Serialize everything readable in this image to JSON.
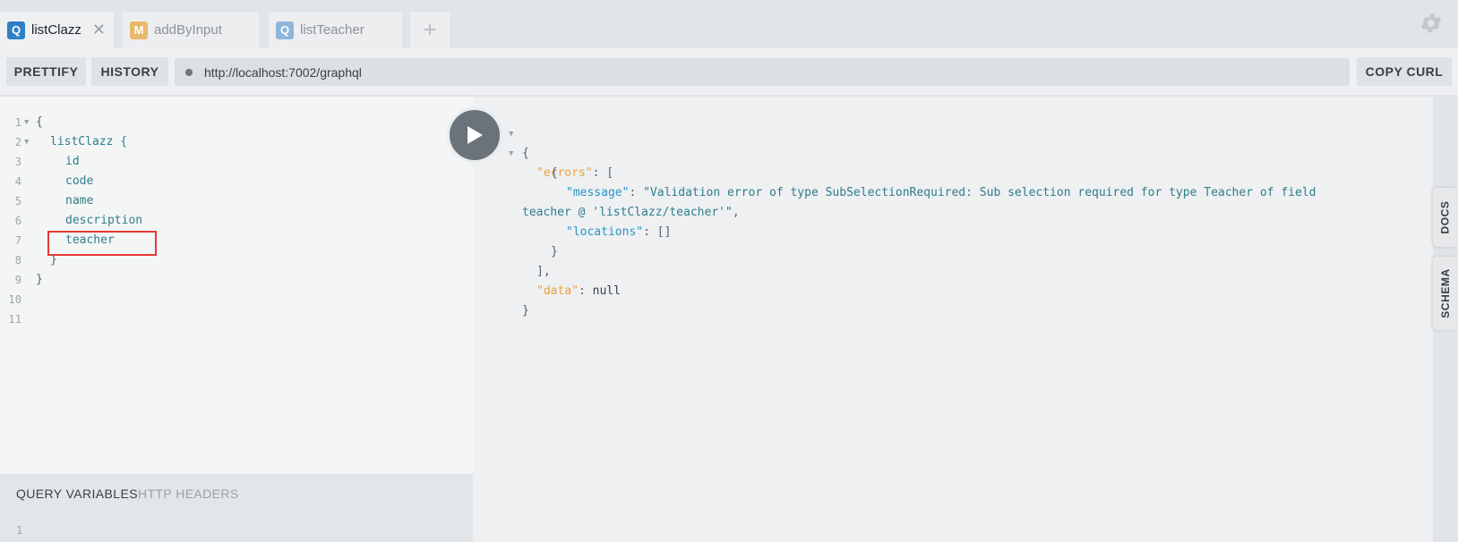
{
  "tabs": [
    {
      "badge": "Q",
      "label": "listClazz",
      "badge_color": "#2e7fc6",
      "closable": true,
      "active": true
    },
    {
      "badge": "M",
      "label": "addByInput",
      "badge_color": "#e8b86b",
      "active": false
    },
    {
      "badge": "Q",
      "label": "listTeacher",
      "badge_color": "#8eb6dc",
      "active": false
    }
  ],
  "toolbar": {
    "prettify_label": "PRETTIFY",
    "history_label": "HISTORY",
    "endpoint_url": "http://localhost:7002/graphql",
    "copy_curl_label": "COPY CURL"
  },
  "query_editor": {
    "lines": [
      {
        "num": "1",
        "text": "{"
      },
      {
        "num": "2",
        "text": "listClazz {"
      },
      {
        "num": "3",
        "text": "id"
      },
      {
        "num": "4",
        "text": "code"
      },
      {
        "num": "5",
        "text": "name"
      },
      {
        "num": "6",
        "text": "description"
      },
      {
        "num": "7",
        "text": "teacher"
      },
      {
        "num": "8",
        "text": "}"
      },
      {
        "num": "9",
        "text": "}"
      },
      {
        "num": "10",
        "text": ""
      },
      {
        "num": "11",
        "text": ""
      }
    ]
  },
  "bottom_panel": {
    "query_variables_label": "QUERY VARIABLES",
    "http_headers_label": "HTTP HEADERS",
    "line_number": "1"
  },
  "response": {
    "errors_key": "\"errors\"",
    "message_key": "\"message\"",
    "message_value_line1": "\"Validation error of type SubSelectionRequired: Sub selection required for type Teacher of field",
    "message_value_line2": "teacher @ 'listClazz/teacher'\"",
    "locations_key": "\"locations\"",
    "locations_value": "[]",
    "data_key": "\"data\"",
    "data_value": "null"
  },
  "side_tabs": {
    "docs_label": "DOCS",
    "schema_label": "SCHEMA"
  },
  "colors": {
    "accent_query": "#2e7fc6",
    "accent_mutation": "#e8b86b",
    "highlight_box": "#e53935"
  }
}
